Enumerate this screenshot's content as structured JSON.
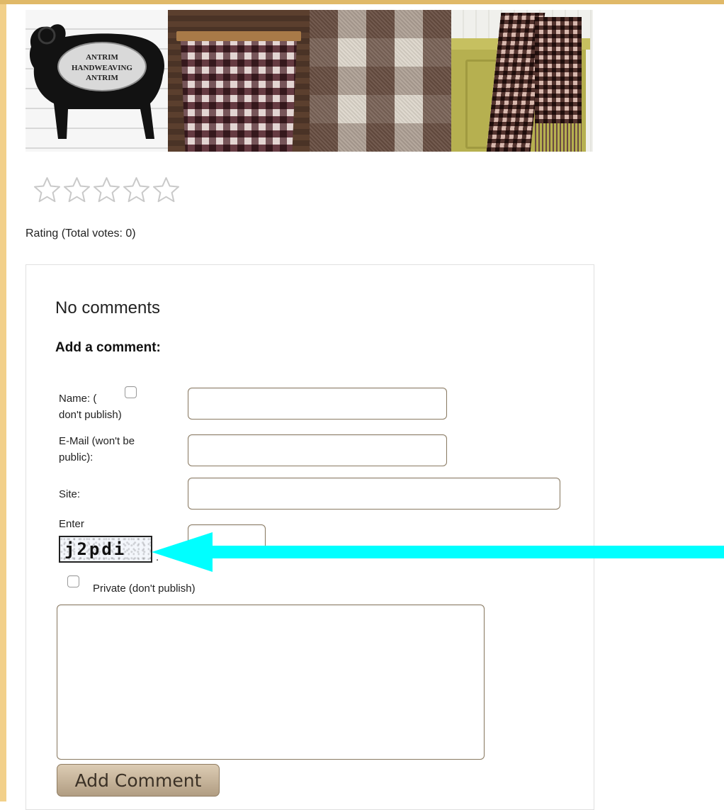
{
  "colors": {
    "page_bg": "#ffffff",
    "gold_frame": "#f2d08a",
    "arrow_cyan": "#00ffff",
    "button_tan": "#c6b59c",
    "input_border": "#8a7a62"
  },
  "banner": {
    "plaque_lines": [
      "ANTRIM",
      "HANDWEAVING",
      "ANTRIM"
    ],
    "icon": "banner-image"
  },
  "rating": {
    "stars_total": 5,
    "stars_filled": 0,
    "icon": "star-outline-icon",
    "label": "Rating (Total votes: 0)"
  },
  "comments": {
    "status": "No comments",
    "heading": "Add a comment:",
    "form": {
      "name_label_a": "Name: (",
      "name_label_b": "don't publish)",
      "email_label_a": "E-Mail (won't be",
      "email_label_b": "public):",
      "site_label": "Site:",
      "captcha_label": "Enter",
      "captcha_text": "j2pdi",
      "captcha_suffix": ".",
      "private_label": "Private (don't publish)",
      "name_value": "",
      "email_value": "",
      "site_value": "",
      "captcha_value": "",
      "message_value": "",
      "submit_label": "Add Comment"
    }
  },
  "annotation": {
    "icon": "arrow-left-icon",
    "color": "#00ffff"
  }
}
